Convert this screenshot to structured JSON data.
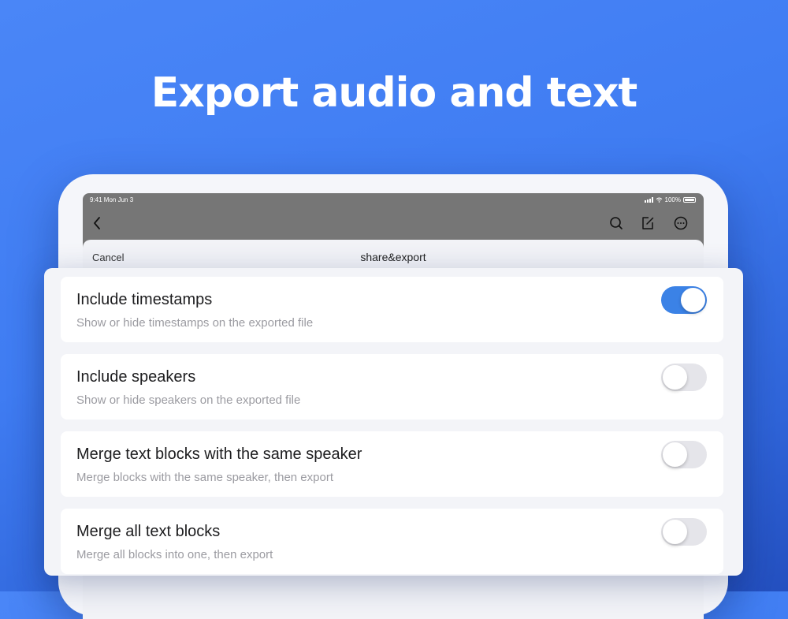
{
  "headline": "Export audio and text",
  "colors": {
    "background": "#4a86f7",
    "accent": "#3b82e6",
    "toggle_off": "#e5e5ea"
  },
  "device": {
    "status_time": "9:41  Mon Jun 3",
    "battery": "100%",
    "icons": [
      "back-icon",
      "search-icon",
      "edit-icon",
      "more-icon"
    ]
  },
  "sheet": {
    "cancel_label": "Cancel",
    "title": "share&export"
  },
  "options": [
    {
      "title": "Include timestamps",
      "description": "Show or hide timestamps on the exported file",
      "enabled": true
    },
    {
      "title": "Include speakers",
      "description": "Show or hide speakers on the exported file",
      "enabled": false
    },
    {
      "title": "Merge text blocks with the same speaker",
      "description": "Merge blocks with the same speaker, then export",
      "enabled": false
    },
    {
      "title": "Merge all text blocks",
      "description": "Merge all blocks into one, then export",
      "enabled": false
    }
  ]
}
